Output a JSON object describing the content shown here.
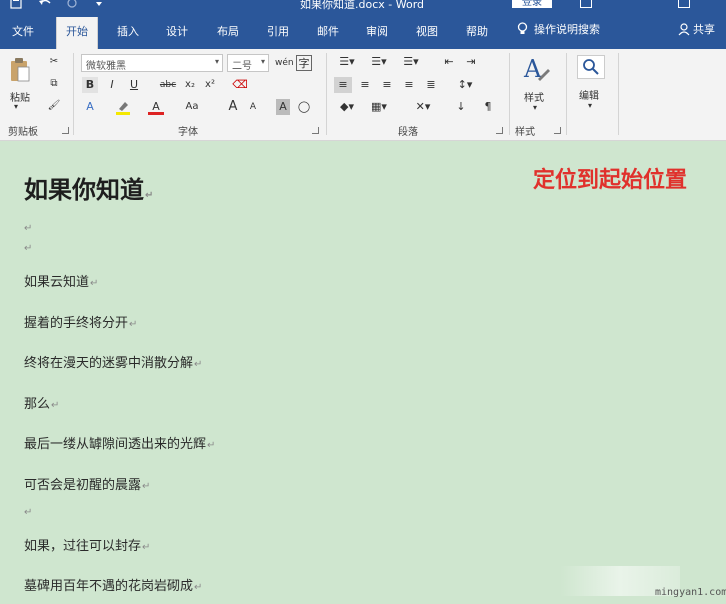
{
  "titlebar": {
    "title": "如果你知道.docx  -  Word",
    "sign_in": "登录"
  },
  "tabs": [
    {
      "label": "文件"
    },
    {
      "label": "开始"
    },
    {
      "label": "插入"
    },
    {
      "label": "设计"
    },
    {
      "label": "布局"
    },
    {
      "label": "引用"
    },
    {
      "label": "邮件"
    },
    {
      "label": "审阅"
    },
    {
      "label": "视图"
    },
    {
      "label": "帮助"
    }
  ],
  "active_tab": "开始",
  "tell_me": "操作说明搜索",
  "share": "共享",
  "ribbon": {
    "clipboard": {
      "paste_label": "粘贴",
      "group_label": "剪贴板"
    },
    "font": {
      "font_name": "微软雅黑",
      "font_size": "二号",
      "phonetic": "wén",
      "bold": "B",
      "italic": "I",
      "underline": "U",
      "strike": "abc",
      "subscript": "x₂",
      "superscript": "x²",
      "text_effects": "A",
      "font_color": "A",
      "change_case": "Aa",
      "grow": "A",
      "shrink": "A",
      "char_shading": "A",
      "enclose": "字",
      "group_label": "字体"
    },
    "paragraph": {
      "group_label": "段落"
    },
    "styles": {
      "styles_label": "样式",
      "group_label": "样式"
    },
    "editing": {
      "editing_label": "编辑"
    }
  },
  "document": {
    "heading": "如果你知道",
    "annotation": "定位到起始位置",
    "paragraph_mark": "↵",
    "lines": [
      "如果云知道",
      "握着的手终将分开",
      "终将在漫天的迷雾中消散分解",
      "那么",
      "最后一缕从罅隙间透出来的光辉",
      "可否会是初醒的晨露",
      "",
      "如果，过往可以封存",
      "墓碑用百年不遇的花岗岩砌成"
    ]
  },
  "watermark": "mingyan1.com",
  "colors": {
    "word_blue": "#2b579a",
    "document_bg": "#cfe6cf",
    "annotation_red": "#e0312c",
    "ribbon_bg": "#f3f3f3"
  }
}
